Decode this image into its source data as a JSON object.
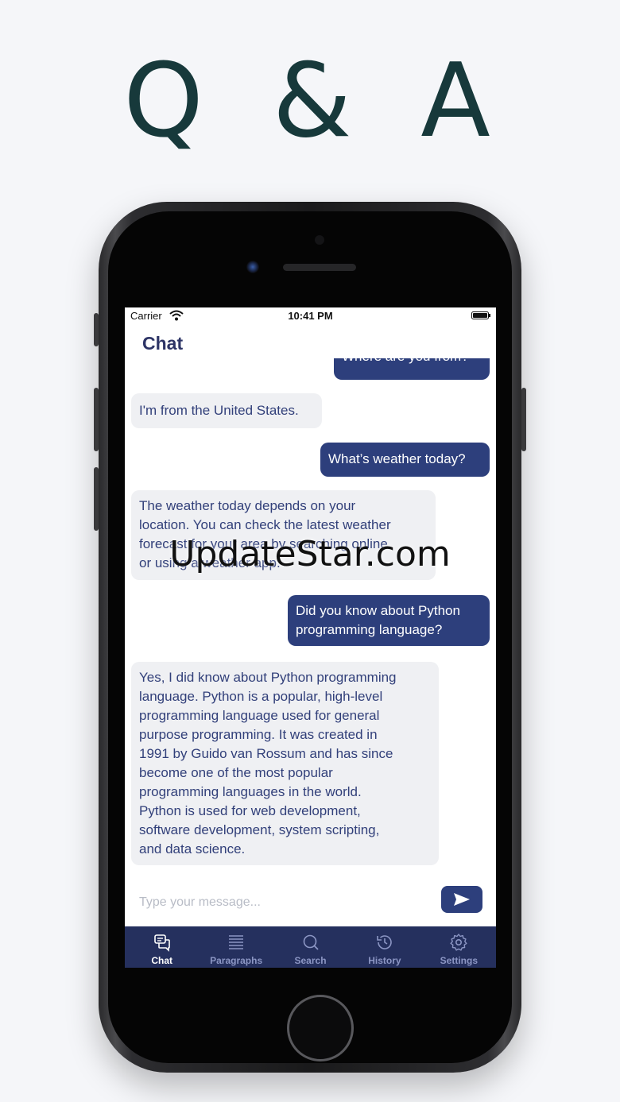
{
  "headline": "Q & A",
  "status_bar": {
    "carrier": "Carrier",
    "time": "10:41 PM"
  },
  "nav": {
    "title": "Chat"
  },
  "messages": [
    {
      "role": "user",
      "text": "Where are you from?"
    },
    {
      "role": "bot",
      "text": "I'm from the United States."
    },
    {
      "role": "user",
      "text": "What’s weather today?"
    },
    {
      "role": "bot",
      "text": "The weather today depends on your\nlocation. You can check the latest weather\nforecast for your area by searching online\nor using a weather app."
    },
    {
      "role": "user",
      "text": "Did you know about Python\nprogramming language?"
    },
    {
      "role": "bot",
      "text": "Yes, I did know about Python programming\nlanguage. Python is a popular, high-level\nprogramming language used for general\npurpose programming. It was created in\n1991 by Guido van Rossum and has since\nbecome one of the most popular\nprogramming languages in the world.\nPython is used for web development,\nsoftware development, system scripting,\nand data science."
    }
  ],
  "input": {
    "placeholder": "Type your message..."
  },
  "tabs": [
    {
      "label": "Chat",
      "icon": "chat-icon",
      "active": true
    },
    {
      "label": "Paragraphs",
      "icon": "paragraphs-icon"
    },
    {
      "label": "Search",
      "icon": "search-icon"
    },
    {
      "label": "History",
      "icon": "history-icon"
    },
    {
      "label": "Settings",
      "icon": "gear-icon"
    }
  ],
  "watermark": "UpdateStar.com",
  "colors": {
    "background": "#f5f6f9",
    "headline": "#17393b",
    "user_bubble": "#2d3f7c",
    "bot_bubble": "#eff0f3",
    "tab_bar": "#25305e"
  }
}
